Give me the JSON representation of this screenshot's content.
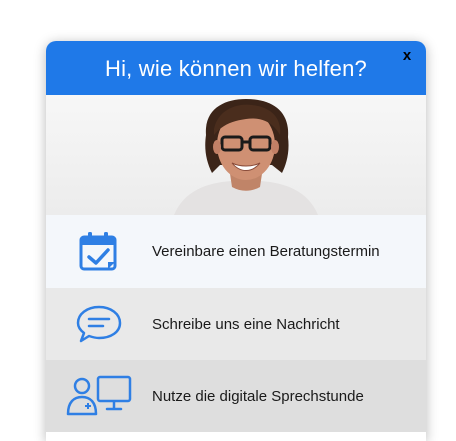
{
  "header": {
    "title": "Hi, wie können wir helfen?",
    "close_label": "x"
  },
  "colors": {
    "accent": "#1f79e8",
    "icon": "#2f7fe4"
  },
  "options": [
    {
      "label": "Vereinbare einen Beratungstermin",
      "icon": "calendar-check-icon"
    },
    {
      "label": "Schreibe uns eine Nachricht",
      "icon": "chat-bubble-icon"
    },
    {
      "label": "Nutze die digitale Sprechstunde",
      "icon": "video-consultation-icon"
    }
  ]
}
